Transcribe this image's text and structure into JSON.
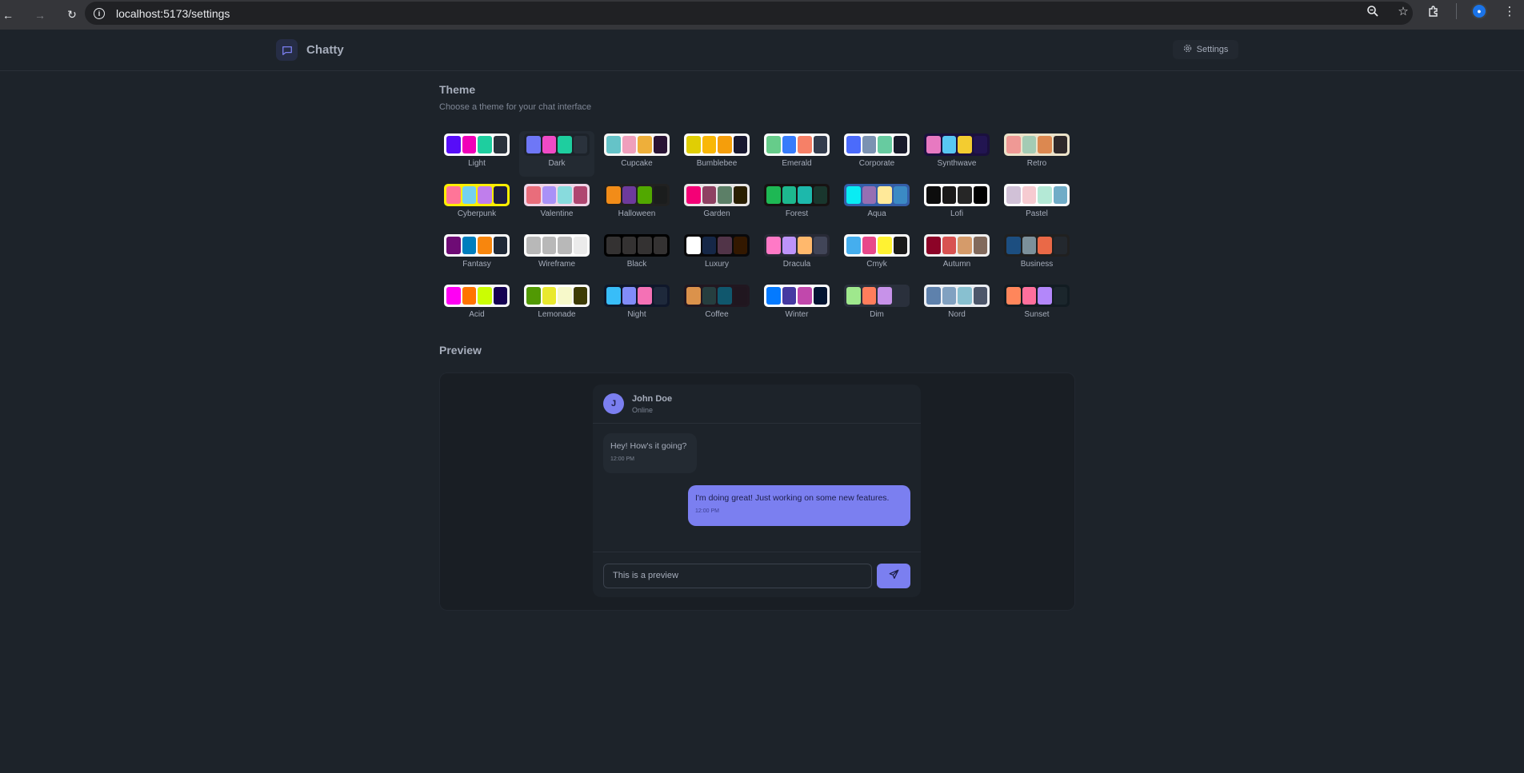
{
  "browser": {
    "url": "localhost:5173/settings"
  },
  "app": {
    "name": "Chatty",
    "settings_label": "Settings"
  },
  "theme_section": {
    "title": "Theme",
    "subtitle": "Choose a theme for your chat interface",
    "selected": "Dark",
    "themes": [
      {
        "name": "Light",
        "colors": [
          "#570df8",
          "#f000b8",
          "#1ece9f",
          "#2a323c"
        ],
        "bg": "#ffffff"
      },
      {
        "name": "Dark",
        "colors": [
          "#6e77f6",
          "#f04ac6",
          "#1ece9f",
          "#2a323c"
        ],
        "bg": "#1d232a"
      },
      {
        "name": "Cupcake",
        "colors": [
          "#65c3c8",
          "#ef9fbc",
          "#eeaf3a",
          "#291334"
        ],
        "bg": "#faf7f5"
      },
      {
        "name": "Bumblebee",
        "colors": [
          "#e0ce04",
          "#f9b707",
          "#f59e0b",
          "#181830"
        ],
        "bg": "#ffffff"
      },
      {
        "name": "Emerald",
        "colors": [
          "#66cc8a",
          "#377cfb",
          "#f68067",
          "#333c4d"
        ],
        "bg": "#ffffff"
      },
      {
        "name": "Corporate",
        "colors": [
          "#4b6bfb",
          "#7b92b2",
          "#67cba0",
          "#181a2a"
        ],
        "bg": "#ffffff"
      },
      {
        "name": "Synthwave",
        "colors": [
          "#e779c1",
          "#58c7f3",
          "#f3cc30",
          "#221551"
        ],
        "bg": "#1a103d"
      },
      {
        "name": "Retro",
        "colors": [
          "#ef9995",
          "#a4cbb4",
          "#dc8850",
          "#2e282a"
        ],
        "bg": "#ece3ca"
      },
      {
        "name": "Cyberpunk",
        "colors": [
          "#ff7598",
          "#75d1f0",
          "#c07eec",
          "#1e1e3f"
        ],
        "bg": "#ffee00"
      },
      {
        "name": "Valentine",
        "colors": [
          "#e96d7b",
          "#a991f7",
          "#88dbdd",
          "#af4670"
        ],
        "bg": "#f0d6e8"
      },
      {
        "name": "Halloween",
        "colors": [
          "#f28c18",
          "#6d3a9c",
          "#51a800",
          "#1b1d1d"
        ],
        "bg": "#212121"
      },
      {
        "name": "Garden",
        "colors": [
          "#f40076",
          "#8e4162",
          "#5c7f67",
          "#291e00"
        ],
        "bg": "#e9e7e7"
      },
      {
        "name": "Forest",
        "colors": [
          "#1eb854",
          "#1db88e",
          "#1db8ab",
          "#19362d"
        ],
        "bg": "#171212"
      },
      {
        "name": "Aqua",
        "colors": [
          "#09ecf3",
          "#966fb3",
          "#ffe999",
          "#3b8ac4"
        ],
        "bg": "#345da7"
      },
      {
        "name": "Lofi",
        "colors": [
          "#0d0d0d",
          "#1a1919",
          "#262626",
          "#000000"
        ],
        "bg": "#ffffff"
      },
      {
        "name": "Pastel",
        "colors": [
          "#d1c1d7",
          "#f6cbd1",
          "#b4e9d6",
          "#70acc7"
        ],
        "bg": "#ffffff"
      },
      {
        "name": "Fantasy",
        "colors": [
          "#6e0b75",
          "#007ebd",
          "#f8860d",
          "#1f2937"
        ],
        "bg": "#ffffff"
      },
      {
        "name": "Wireframe",
        "colors": [
          "#b8b8b8",
          "#b8b8b8",
          "#b8b8b8",
          "#ebebeb"
        ],
        "bg": "#ffffff"
      },
      {
        "name": "Black",
        "colors": [
          "#343232",
          "#343232",
          "#343232",
          "#343232"
        ],
        "bg": "#000000"
      },
      {
        "name": "Luxury",
        "colors": [
          "#ffffff",
          "#152747",
          "#513448",
          "#331800"
        ],
        "bg": "#09090b"
      },
      {
        "name": "Dracula",
        "colors": [
          "#ff79c6",
          "#bd93f9",
          "#ffb86c",
          "#414558"
        ],
        "bg": "#282a36"
      },
      {
        "name": "Cmyk",
        "colors": [
          "#45aeee",
          "#e8488a",
          "#fff232",
          "#1a1a1a"
        ],
        "bg": "#ffffff"
      },
      {
        "name": "Autumn",
        "colors": [
          "#8c0327",
          "#d85251",
          "#d59b6a",
          "#826a5c"
        ],
        "bg": "#f1f1f1"
      },
      {
        "name": "Business",
        "colors": [
          "#1c4e80",
          "#7c909a",
          "#ea6947",
          "#23282e"
        ],
        "bg": "#202020"
      },
      {
        "name": "Acid",
        "colors": [
          "#ff00f4",
          "#ff7400",
          "#cbfd03",
          "#140152"
        ],
        "bg": "#fafafa"
      },
      {
        "name": "Lemonade",
        "colors": [
          "#519903",
          "#e9e92e",
          "#f7f9ca",
          "#3d3b04"
        ],
        "bg": "#ffffff"
      },
      {
        "name": "Night",
        "colors": [
          "#38bdf8",
          "#818cf8",
          "#f471b5",
          "#1e293b"
        ],
        "bg": "#0f172a"
      },
      {
        "name": "Coffee",
        "colors": [
          "#db924b",
          "#263e3f",
          "#10576d",
          "#20161f"
        ],
        "bg": "#211720"
      },
      {
        "name": "Winter",
        "colors": [
          "#047aff",
          "#463aa2",
          "#c148ac",
          "#021431"
        ],
        "bg": "#ffffff"
      },
      {
        "name": "Dim",
        "colors": [
          "#9fe88d",
          "#ff7d5c",
          "#c792e9",
          "#2a303c"
        ],
        "bg": "#2a303c"
      },
      {
        "name": "Nord",
        "colors": [
          "#5e81ac",
          "#81a1c1",
          "#88c0d0",
          "#4c566a"
        ],
        "bg": "#eceff4"
      },
      {
        "name": "Sunset",
        "colors": [
          "#ff865b",
          "#fd6f9c",
          "#b387fa",
          "#1b262c"
        ],
        "bg": "#121c22"
      }
    ]
  },
  "preview": {
    "title": "Preview",
    "contact_initial": "J",
    "contact_name": "John Doe",
    "contact_status": "Online",
    "messages": [
      {
        "text": "Hey! How's it going?",
        "time": "12:00 PM",
        "from_me": false
      },
      {
        "text": "I'm doing great! Just working on some new features.",
        "time": "12:00 PM",
        "from_me": true
      }
    ],
    "input_value": "This is a preview"
  },
  "colors": {
    "primary": "#7b7ff0",
    "base": "#1d232a"
  }
}
